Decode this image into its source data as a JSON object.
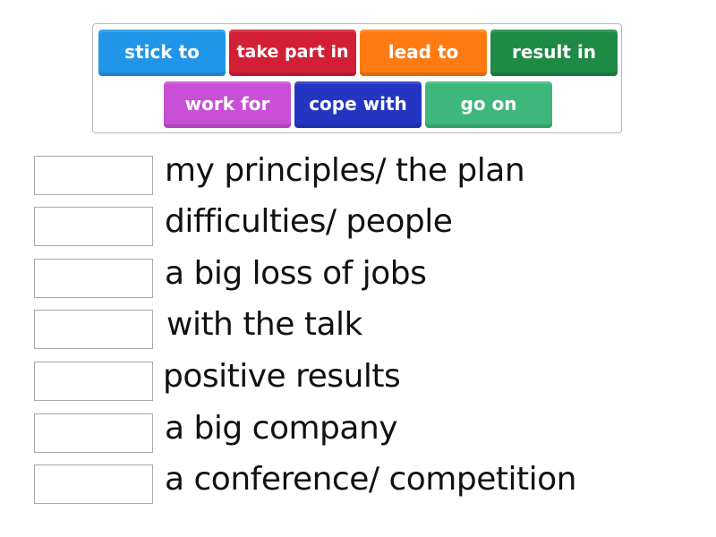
{
  "word_bank": {
    "tiles": [
      {
        "label": "stick to",
        "color": "#2196e8"
      },
      {
        "label": "take part in",
        "color": "#d31f35"
      },
      {
        "label": "lead to",
        "color": "#ff7b12"
      },
      {
        "label": "result in",
        "color": "#1f8a46"
      },
      {
        "label": "work for",
        "color": "#c94fd6"
      },
      {
        "label": "cope with",
        "color": "#2435c2"
      },
      {
        "label": "go on",
        "color": "#3eb77a"
      }
    ]
  },
  "items": [
    {
      "answer": "",
      "phrase": "my principles/ the plan"
    },
    {
      "answer": "",
      "phrase": "difficulties/ people"
    },
    {
      "answer": "",
      "phrase": "a big loss of jobs"
    },
    {
      "answer": "",
      "phrase": "with the talk"
    },
    {
      "answer": "",
      "phrase": "positive results"
    },
    {
      "answer": "",
      "phrase": "a big company"
    },
    {
      "answer": "",
      "phrase": "a conference/ competition"
    }
  ]
}
